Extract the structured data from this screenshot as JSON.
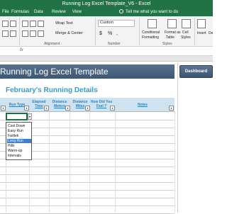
{
  "window": {
    "title": "Running Log Excel Template_V6  -  Excel"
  },
  "ribbon_tabs": [
    "File",
    "Formulas",
    "Data",
    "Review",
    "View"
  ],
  "tell_me": "Tell me what you want to do",
  "ribbon": {
    "wrap_text": "Wrap Text",
    "merge_center": "Merge & Center",
    "number_format": "Custom",
    "currency_symbol": "$",
    "percent_symbol": "%",
    "comma_symbol": ",",
    "conditional_formatting": "Conditional",
    "conditional_formatting_2": "Formatting",
    "format_as_table": "Format as",
    "format_as_table_2": "Table",
    "cell_styles": "Cell",
    "cell_styles_2": "Styles",
    "insert": "Insert",
    "delete": "De",
    "group_alignment": "Alignment",
    "group_number": "Number",
    "group_styles": "Styles"
  },
  "banner": {
    "title": "Running Log Excel Template",
    "dashboard_button": "Dashboard"
  },
  "sheet": {
    "title": "February's Running Details",
    "headers": {
      "run_type": "Run Type",
      "elapsed_1": "Elapsed",
      "elapsed_2": "Time",
      "distance_meters_1": "Distance",
      "distance_meters_2": "Meters",
      "distance_miles_1": "Distance",
      "distance_miles_2": "Miles",
      "feel_1": "How Did You",
      "feel_2": "Feel ?",
      "notes": "Notes"
    }
  },
  "run_type_dropdown": {
    "options": [
      "Cool Down",
      "Easy Run",
      "Fartlek",
      "Long Run",
      "Hills",
      "Warm-up",
      "Intervals"
    ],
    "highlighted": "Long Run"
  },
  "colors": {
    "excel_green": "#217346",
    "banner": "#4a6481",
    "header_fill": "#cfe2ef",
    "title_blue": "#2e9fd6",
    "highlight": "#3f7fd1"
  }
}
